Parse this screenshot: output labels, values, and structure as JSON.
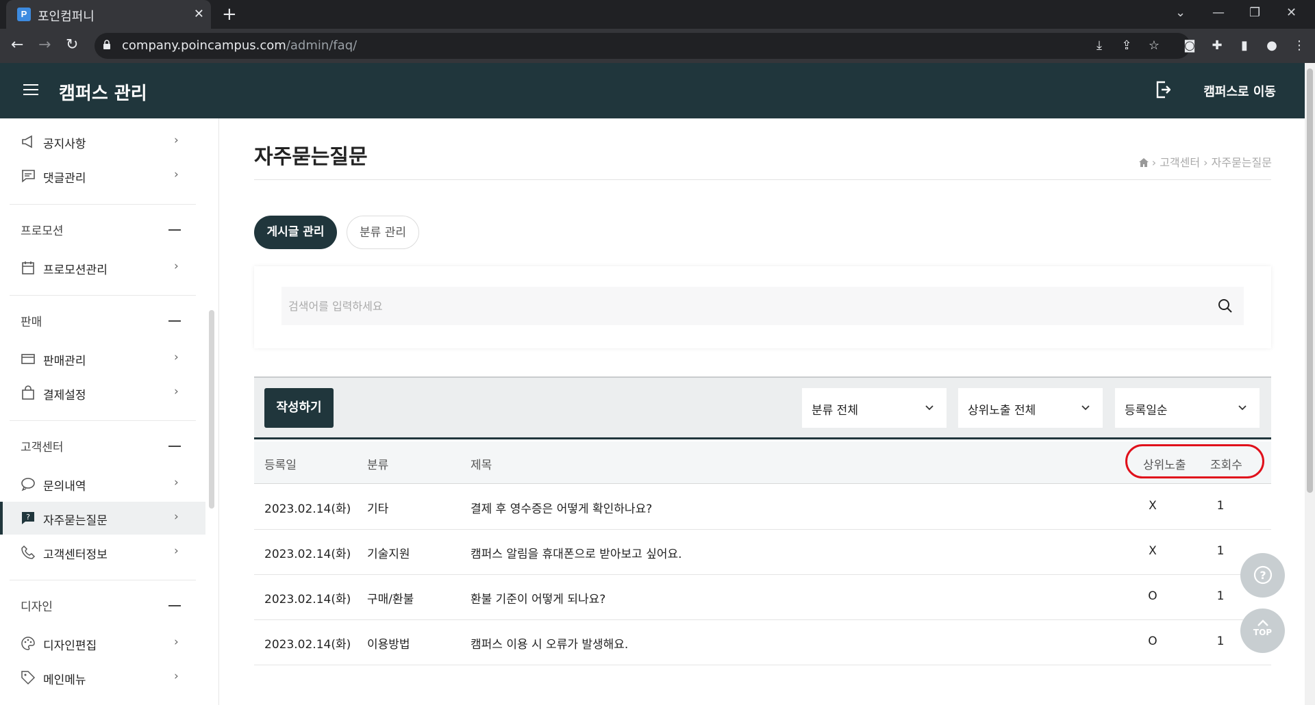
{
  "browser": {
    "tab_title": "포인컴퍼니",
    "favicon_letter": "P",
    "url_host": "company.poincampus.com",
    "url_path": "/admin/faq/"
  },
  "header": {
    "title": "캠퍼스 관리",
    "goto_label": "캠퍼스로 이동"
  },
  "sidebar": {
    "items_top": [
      {
        "label": "공지사항",
        "icon": "megaphone-icon"
      },
      {
        "label": "댓글관리",
        "icon": "comment-icon"
      }
    ],
    "groups": [
      {
        "title": "프로모션",
        "items": [
          {
            "label": "프로모션관리",
            "icon": "calendar-icon"
          }
        ]
      },
      {
        "title": "판매",
        "items": [
          {
            "label": "판매관리",
            "icon": "card-icon"
          },
          {
            "label": "결제설정",
            "icon": "bag-icon"
          }
        ]
      },
      {
        "title": "고객센터",
        "items": [
          {
            "label": "문의내역",
            "icon": "chat-icon"
          },
          {
            "label": "자주묻는질문",
            "icon": "faq-icon"
          },
          {
            "label": "고객센터정보",
            "icon": "phone-icon"
          }
        ]
      },
      {
        "title": "디자인",
        "items": [
          {
            "label": "디자인편집",
            "icon": "palette-icon"
          },
          {
            "label": "메인메뉴",
            "icon": "tag-icon"
          }
        ]
      }
    ]
  },
  "page": {
    "title": "자주묻는질문",
    "breadcrumb": [
      "고객센터",
      "자주묻는질문"
    ],
    "tabs": [
      "게시글 관리",
      "분류 관리"
    ],
    "search_placeholder": "검색어를 입력하세요",
    "write_button": "작성하기",
    "filters": [
      "분류 전체",
      "상위노출 전체",
      "등록일순"
    ]
  },
  "table": {
    "columns": [
      "등록일",
      "분류",
      "제목",
      "상위노출",
      "조회수"
    ],
    "rows": [
      {
        "date": "2023.02.14(화)",
        "category": "기타",
        "title": "결제 후 영수증은 어떻게 확인하나요?",
        "top": "X",
        "views": "1"
      },
      {
        "date": "2023.02.14(화)",
        "category": "기술지원",
        "title": "캠퍼스 알림을 휴대폰으로 받아보고 싶어요.",
        "top": "X",
        "views": "1"
      },
      {
        "date": "2023.02.14(화)",
        "category": "구매/환불",
        "title": "환불 기준이 어떻게 되나요?",
        "top": "O",
        "views": "1"
      },
      {
        "date": "2023.02.14(화)",
        "category": "이용방법",
        "title": "캠퍼스 이용 시 오류가 발생해요.",
        "top": "O",
        "views": "1"
      }
    ]
  },
  "floating": {
    "help_glyph": "?",
    "top_label": "TOP"
  },
  "colors": {
    "brand_dark": "#20363c",
    "highlight": "#e0101b"
  }
}
